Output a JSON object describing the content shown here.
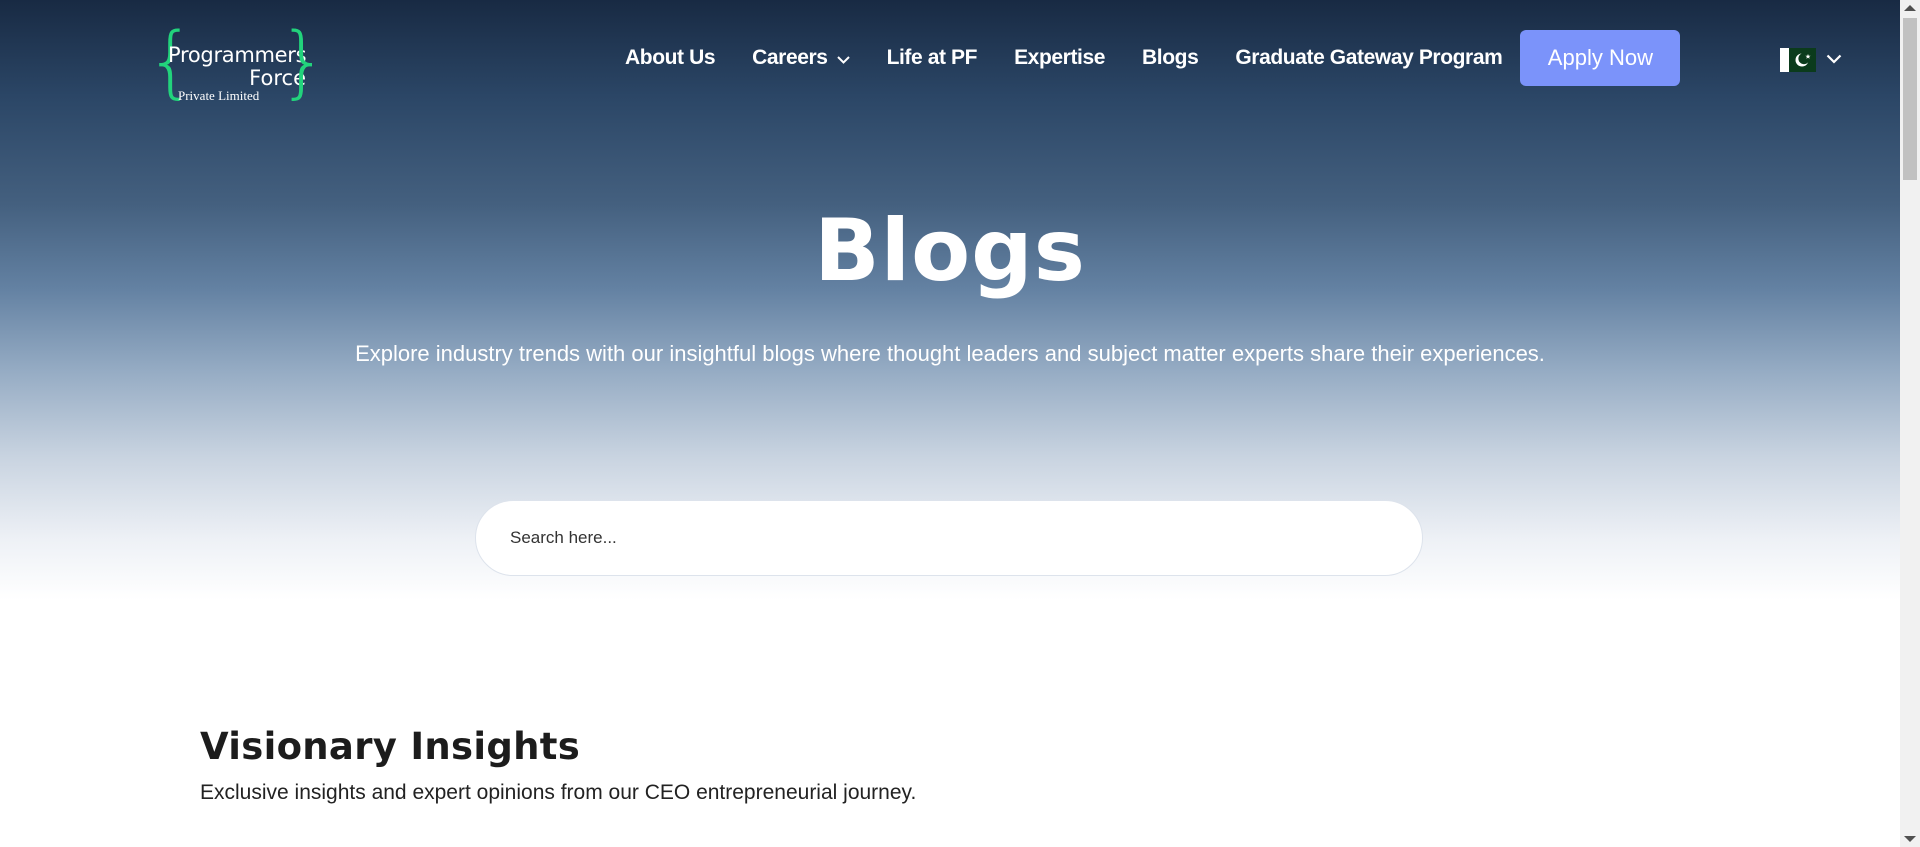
{
  "logo": {
    "line1": "Programmers",
    "line2": "Force",
    "line3": "Private Limited",
    "brace_color": "#22d37c"
  },
  "nav": {
    "items": [
      {
        "label": "About Us"
      },
      {
        "label": "Careers",
        "has_dropdown": true,
        "icon": "chevron-down-icon"
      },
      {
        "label": "Life at PF"
      },
      {
        "label": "Expertise"
      },
      {
        "label": "Blogs"
      },
      {
        "label": "Graduate Gateway Program"
      }
    ],
    "apply_label": "Apply Now",
    "apply_color": "#7b93fa",
    "language": {
      "flag": "pakistan-flag-icon",
      "icon": "chevron-down-icon"
    }
  },
  "hero": {
    "title": "Blogs",
    "subtitle": "Explore industry trends with our insightful blogs where thought leaders and subject matter experts share their experiences."
  },
  "search": {
    "placeholder": "Search here..."
  },
  "section": {
    "title": "Visionary Insights",
    "subtitle": "Exclusive insights and expert opinions from our CEO entrepreneurial journey."
  }
}
